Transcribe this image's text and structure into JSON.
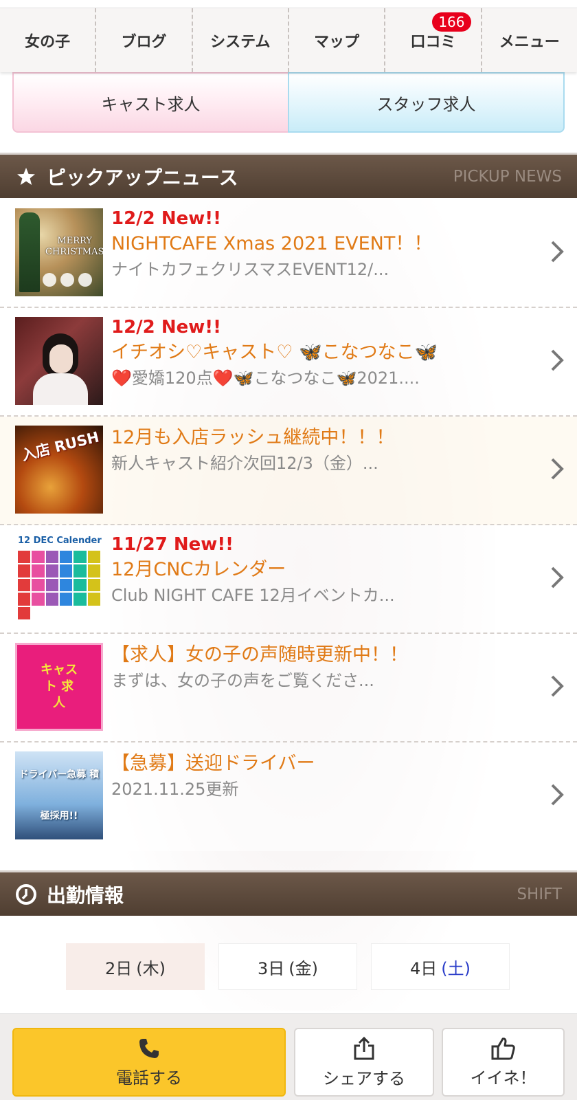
{
  "nav": {
    "items": [
      {
        "label": "女の子"
      },
      {
        "label": "ブログ"
      },
      {
        "label": "システム"
      },
      {
        "label": "マップ"
      },
      {
        "label": "口コミ",
        "badge": "166"
      },
      {
        "label": "メニュー"
      }
    ]
  },
  "recruit": {
    "cast_label": "キャスト求人",
    "staff_label": "スタッフ求人"
  },
  "pickup": {
    "title": "ピックアップニュース",
    "subtitle": "PICKUP NEWS",
    "items": [
      {
        "date": "12/2 New!!",
        "title": "NIGHTCAFE Xmas 2021 EVENT！！",
        "desc": "ナイトカフェクリスマスEVENT12/...",
        "thumb_text": "MERRY CHRISTMAS"
      },
      {
        "date": "12/2 New!!",
        "title": "イチオシ♡キャスト♡ 🦋こなつなこ🦋",
        "desc": "❤️愛嬌120点❤️🦋こなつなこ🦋2021....",
        "thumb_text": ""
      },
      {
        "date": "",
        "title": "12月も入店ラッシュ継続中！！！",
        "desc": "新人キャスト紹介次回12/3（金）...",
        "thumb_text": "入店 RUSH"
      },
      {
        "date": "11/27 New!!",
        "title": "12月CNCカレンダー",
        "desc": "Club NIGHT CAFE 12月イベントカ...",
        "thumb_text": "12 DEC Calender"
      },
      {
        "date": "",
        "title": "【求人】女の子の声随時更新中！！",
        "desc": "まずは、女の子の声をご覧くださ...",
        "thumb_text": "キャスト 求人"
      },
      {
        "date": "",
        "title": "【急募】送迎ドライバー",
        "desc": "2021.11.25更新",
        "thumb_text": "ドライバー急募 積極採用!!"
      }
    ]
  },
  "shift": {
    "title": "出勤情報",
    "subtitle": "SHIFT",
    "days": [
      {
        "day": "2日",
        "weekday": "(木)"
      },
      {
        "day": "3日",
        "weekday": "(金)"
      },
      {
        "day": "4日",
        "weekday": "(土)"
      }
    ]
  },
  "bottom": {
    "call_label": "電話する",
    "share_label": "シェアする",
    "like_label": "イイネ！"
  },
  "colors": {
    "header_bg": "#5a4739",
    "news_title": "#e07a16",
    "news_date": "#e01b1b",
    "call_button": "#fbc62a",
    "badge": "#e8001c"
  }
}
